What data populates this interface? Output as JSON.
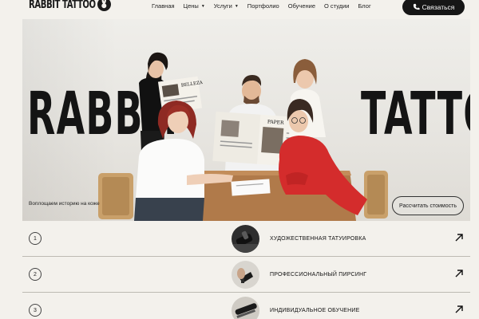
{
  "header": {
    "logo_text": "RABBIT TATTOO",
    "logo_icon": "rabbit-icon",
    "nav": [
      {
        "label": "Главная",
        "dropdown": false
      },
      {
        "label": "Цены",
        "dropdown": true
      },
      {
        "label": "Услуги",
        "dropdown": true
      },
      {
        "label": "Портфолио",
        "dropdown": false
      },
      {
        "label": "Обучение",
        "dropdown": false
      },
      {
        "label": "О студии",
        "dropdown": false
      },
      {
        "label": "Блог",
        "dropdown": false
      }
    ],
    "contact": {
      "label": "Связаться",
      "icon": "phone-icon"
    }
  },
  "hero": {
    "title_left": "RABBIT",
    "title_right": "TATTOO",
    "caption": "Воплощаем историю на коже",
    "price_button": "Рассчитать стоимость",
    "newspaper_left": "BELLEZA",
    "newspaper_right": "PAPER"
  },
  "services": [
    {
      "number": "1",
      "label": "ХУДОЖЕСТВЕННАЯ ТАТУИРОВКА",
      "icon": "arrow-up-right-icon"
    },
    {
      "number": "2",
      "label": "ПРОФЕССИОНАЛЬНЫЙ ПИРСИНГ",
      "icon": "arrow-up-right-icon"
    },
    {
      "number": "3",
      "label": "ИНДИВИДУАЛЬНОЕ ОБУЧЕНИЕ",
      "icon": "arrow-up-right-icon"
    }
  ],
  "colors": {
    "background": "#f3f1ec",
    "dark": "#161616",
    "accent_red": "#d42c2c",
    "table_wood": "#b07a4a"
  }
}
